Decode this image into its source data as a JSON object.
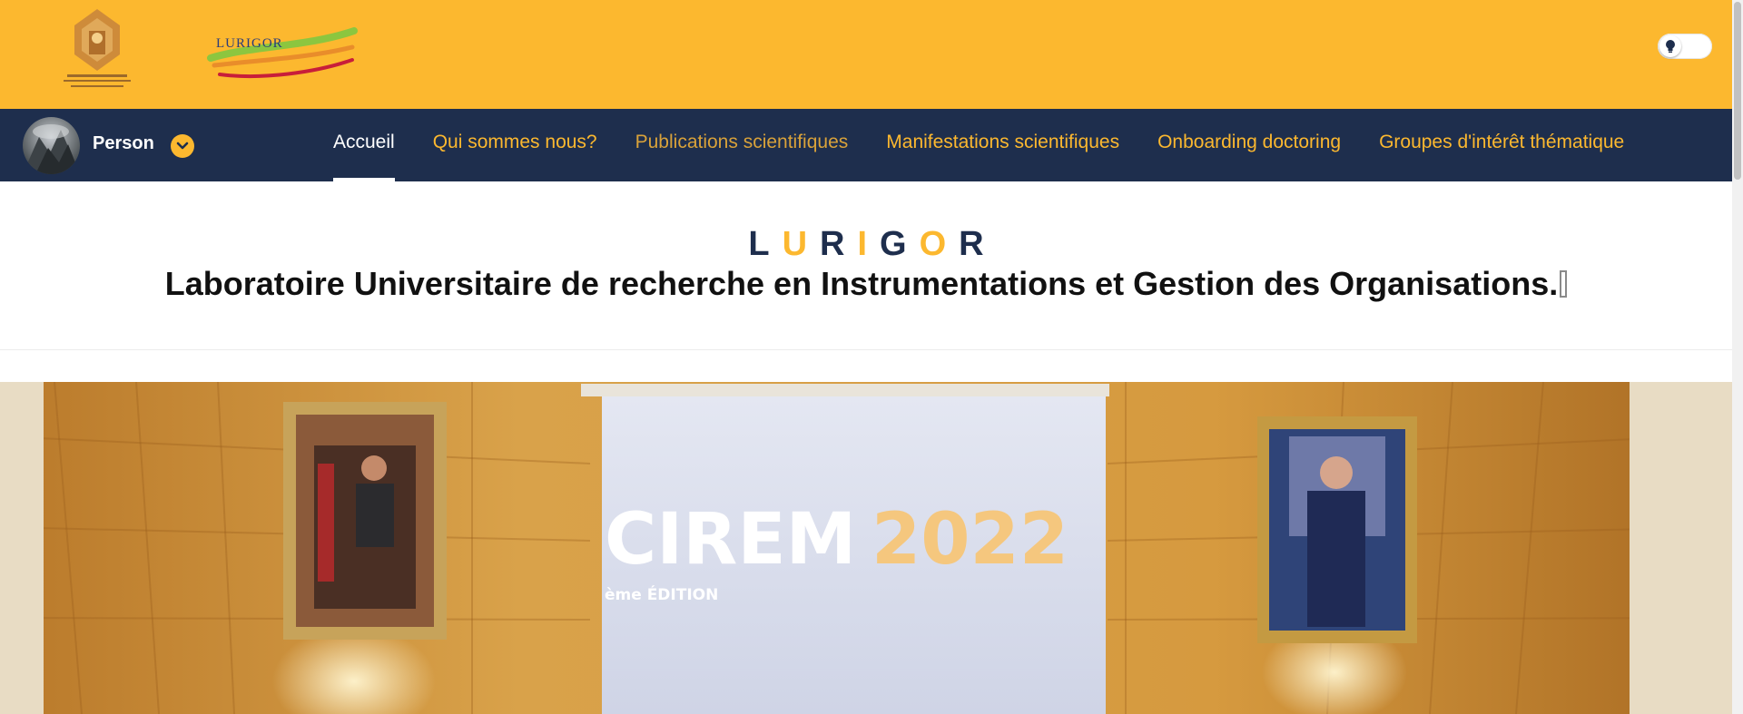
{
  "header": {
    "university_logo": "university-crest-logo",
    "lab_logo_text": "LURIGOR",
    "theme_toggle_icon": "lightbulb-icon",
    "colors": {
      "topbar": "#fcb82f",
      "navbar": "#1e2e4d",
      "accent": "#fcb82f"
    }
  },
  "user": {
    "name": "Person",
    "menu_icon": "chevron-down-icon"
  },
  "nav": {
    "items": [
      {
        "label": "Accueil",
        "active": true
      },
      {
        "label": "Qui sommes nous?"
      },
      {
        "label": "Publications scientifiques"
      },
      {
        "label": "Manifestations scientifiques"
      },
      {
        "label": "Onboarding doctoring"
      },
      {
        "label": "Groupes d'intérêt thématique"
      }
    ]
  },
  "hero": {
    "brand_letters": [
      {
        "char": "L",
        "color": "#1e2e4d"
      },
      {
        "char": "U",
        "color": "#fcb82f"
      },
      {
        "char": "R",
        "color": "#1e2e4d"
      },
      {
        "char": "I",
        "color": "#fcb82f"
      },
      {
        "char": "G",
        "color": "#1e2e4d"
      },
      {
        "char": "O",
        "color": "#fcb82f"
      },
      {
        "char": "R",
        "color": "#1e2e4d"
      }
    ],
    "subtitle": "Laboratoire Universitaire de recherche en Instrumentations et Gestion des Organisations."
  },
  "banner": {
    "screen_text_left": "CIREM",
    "screen_text_right": "2022",
    "screen_subtext": "ème ÉDITION"
  }
}
